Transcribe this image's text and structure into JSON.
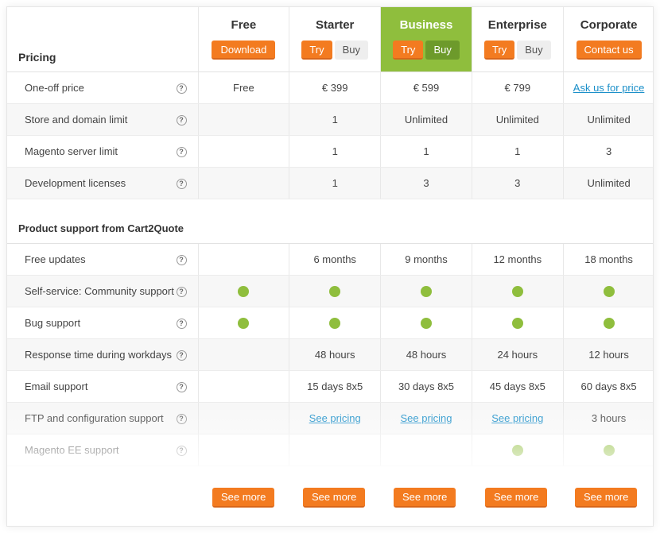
{
  "header": {
    "section_label": "Pricing",
    "plans": [
      {
        "name": "Free",
        "buttons": [
          {
            "label": "Download",
            "style": "orange"
          }
        ]
      },
      {
        "name": "Starter",
        "buttons": [
          {
            "label": "Try",
            "style": "orange"
          },
          {
            "label": "Buy",
            "style": "grey"
          }
        ]
      },
      {
        "name": "Business",
        "highlight": true,
        "buttons": [
          {
            "label": "Try",
            "style": "orange"
          },
          {
            "label": "Buy",
            "style": "green"
          }
        ]
      },
      {
        "name": "Enterprise",
        "buttons": [
          {
            "label": "Try",
            "style": "orange"
          },
          {
            "label": "Buy",
            "style": "grey"
          }
        ]
      },
      {
        "name": "Corporate",
        "buttons": [
          {
            "label": "Contact us",
            "style": "orange"
          }
        ]
      }
    ]
  },
  "pricing_rows": [
    {
      "label": "One-off price",
      "values": [
        "Free",
        "€ 399",
        "€ 599",
        "€ 799",
        "Ask us for price"
      ]
    },
    {
      "label": "Store and domain limit",
      "values": [
        "",
        "1",
        "Unlimited",
        "Unlimited",
        "Unlimited"
      ]
    },
    {
      "label": "Magento server limit",
      "values": [
        "",
        "1",
        "1",
        "1",
        "3"
      ]
    },
    {
      "label": "Development licenses",
      "values": [
        "",
        "1",
        "3",
        "3",
        "Unlimited"
      ]
    }
  ],
  "support_section_label": "Product support from Cart2Quote",
  "support_rows": [
    {
      "label": "Free updates",
      "values": [
        "",
        "6 months",
        "9 months",
        "12 months",
        "18 months"
      ]
    },
    {
      "label": "Self-service: Community support",
      "values": [
        "",
        "",
        "",
        "",
        ""
      ]
    },
    {
      "label": "Bug support",
      "values": [
        "",
        "",
        "",
        "",
        ""
      ]
    },
    {
      "label": "Response time during workdays",
      "values": [
        "",
        "48 hours",
        "48 hours",
        "24 hours",
        "12 hours"
      ]
    },
    {
      "label": "Email support",
      "values": [
        "",
        "15 days 8x5",
        "30 days 8x5",
        "45 days 8x5",
        "60 days 8x5"
      ]
    },
    {
      "label": "FTP and configuration support",
      "values": [
        "",
        "See pricing",
        "See pricing",
        "See pricing",
        "3 hours"
      ]
    },
    {
      "label": "Magento EE support",
      "values": [
        "",
        "",
        "",
        "",
        ""
      ]
    }
  ],
  "help_icon_glyph": "?",
  "see_more_label": "See more",
  "colors": {
    "accent_orange": "#f37b20",
    "accent_green": "#8fbe3d",
    "link_blue": "#1a8fc9"
  }
}
